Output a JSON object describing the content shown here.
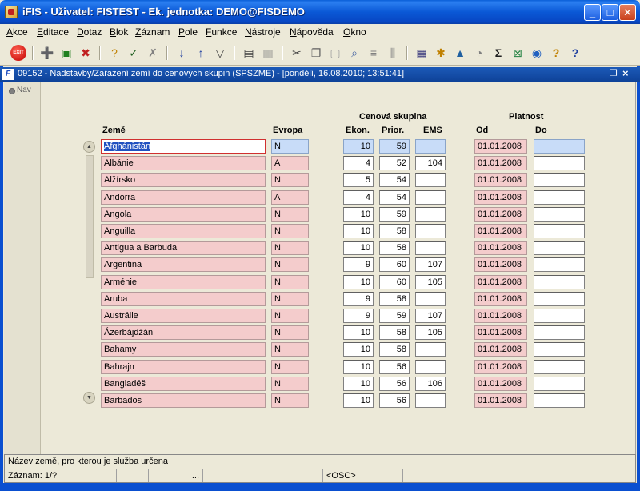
{
  "window": {
    "title": "iFIS - Uživatel: FISTEST - Ek. jednotka: DEMO@FISDEMO",
    "minimize": "_",
    "maximize": "□",
    "close": "✕"
  },
  "menu": [
    "Akce",
    "Editace",
    "Dotaz",
    "Blok",
    "Záznam",
    "Pole",
    "Funkce",
    "Nástroje",
    "Nápověda",
    "Okno"
  ],
  "toolbar": {
    "exit_label": "EXIT",
    "icons": [
      "add-record-icon",
      "save-icon",
      "delete-record-icon",
      "enter-query-icon",
      "execute-query-icon",
      "cancel-query-icon",
      "sort-asc-icon",
      "sort-desc-icon",
      "filter-icon",
      "print-icon",
      "print-setup-icon",
      "cut-icon",
      "copy-icon",
      "paste-icon",
      "find-icon",
      "list-icon",
      "columns-icon",
      "calculator-icon",
      "tools-icon",
      "chart-icon",
      "note-icon",
      "sum-icon",
      "excel-icon",
      "globe-icon",
      "help-icon",
      "context-help-icon"
    ]
  },
  "form": {
    "icon_label": "F",
    "title": "09152 - Nadstavby/Zařazení zemí do cenových skupin (SPSZME) - [pondělí, 16.08.2010; 13:51:41]",
    "nav_label": "Nav"
  },
  "headers": {
    "group_price": "Cenová skupina",
    "group_validity": "Platnost",
    "country": "Země",
    "europe": "Evropa",
    "econ": "Ekon.",
    "prior": "Prior.",
    "ems": "EMS",
    "from": "Od",
    "to": "Do"
  },
  "rows": [
    {
      "country": "Afghánistán",
      "europe": "N",
      "econ": "10",
      "prior": "59",
      "ems": "",
      "from": "01.01.2008",
      "to": ""
    },
    {
      "country": "Albánie",
      "europe": "A",
      "econ": "4",
      "prior": "52",
      "ems": "104",
      "from": "01.01.2008",
      "to": ""
    },
    {
      "country": "Alžírsko",
      "europe": "N",
      "econ": "5",
      "prior": "54",
      "ems": "",
      "from": "01.01.2008",
      "to": ""
    },
    {
      "country": "Andorra",
      "europe": "A",
      "econ": "4",
      "prior": "54",
      "ems": "",
      "from": "01.01.2008",
      "to": ""
    },
    {
      "country": "Angola",
      "europe": "N",
      "econ": "10",
      "prior": "59",
      "ems": "",
      "from": "01.01.2008",
      "to": ""
    },
    {
      "country": "Anguilla",
      "europe": "N",
      "econ": "10",
      "prior": "58",
      "ems": "",
      "from": "01.01.2008",
      "to": ""
    },
    {
      "country": "Antigua a Barbuda",
      "europe": "N",
      "econ": "10",
      "prior": "58",
      "ems": "",
      "from": "01.01.2008",
      "to": ""
    },
    {
      "country": "Argentina",
      "europe": "N",
      "econ": "9",
      "prior": "60",
      "ems": "107",
      "from": "01.01.2008",
      "to": ""
    },
    {
      "country": "Arménie",
      "europe": "N",
      "econ": "10",
      "prior": "60",
      "ems": "105",
      "from": "01.01.2008",
      "to": ""
    },
    {
      "country": "Aruba",
      "europe": "N",
      "econ": "9",
      "prior": "58",
      "ems": "",
      "from": "01.01.2008",
      "to": ""
    },
    {
      "country": "Austrálie",
      "europe": "N",
      "econ": "9",
      "prior": "59",
      "ems": "107",
      "from": "01.01.2008",
      "to": ""
    },
    {
      "country": "Ázerbájdžán",
      "europe": "N",
      "econ": "10",
      "prior": "58",
      "ems": "105",
      "from": "01.01.2008",
      "to": ""
    },
    {
      "country": "Bahamy",
      "europe": "N",
      "econ": "10",
      "prior": "58",
      "ems": "",
      "from": "01.01.2008",
      "to": ""
    },
    {
      "country": "Bahrajn",
      "europe": "N",
      "econ": "10",
      "prior": "56",
      "ems": "",
      "from": "01.01.2008",
      "to": ""
    },
    {
      "country": "Bangladéš",
      "europe": "N",
      "econ": "10",
      "prior": "56",
      "ems": "106",
      "from": "01.01.2008",
      "to": ""
    },
    {
      "country": "Barbados",
      "europe": "N",
      "econ": "10",
      "prior": "56",
      "ems": "",
      "from": "01.01.2008",
      "to": ""
    }
  ],
  "status": {
    "hint": "Název země, pro kterou je služba určena",
    "record": "Záznam: 1/?",
    "ellipsis": "...",
    "osc": "<OSC>"
  }
}
